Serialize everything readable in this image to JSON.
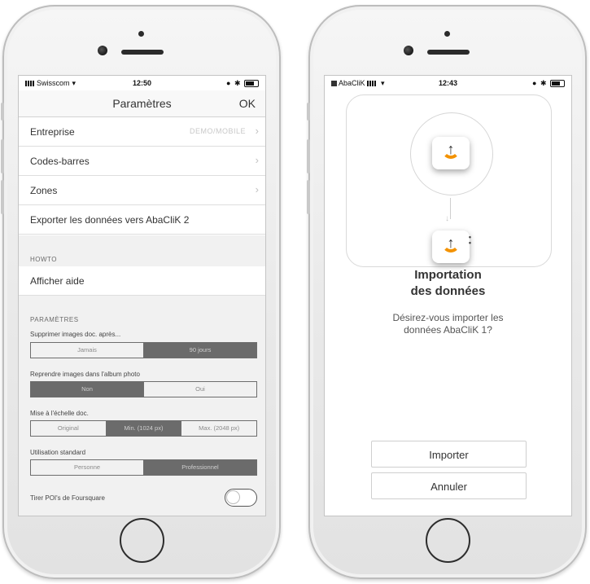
{
  "left": {
    "status": {
      "carrier": "Swisscom",
      "time": "12:50"
    },
    "nav": {
      "title": "Paramètres",
      "ok": "OK"
    },
    "rows": [
      {
        "label": "Entreprise",
        "value": "DEMO/MOBILE"
      },
      {
        "label": "Codes-barres",
        "value": ""
      },
      {
        "label": "Zones",
        "value": ""
      },
      {
        "label": "Exporter les données vers AbaCliK 2",
        "value": ""
      }
    ],
    "howto": {
      "section": "HOWTO",
      "item": "Afficher aide"
    },
    "settings": {
      "section": "PARAMÈTRES",
      "delete_images": {
        "label": "Supprimer images doc. après...",
        "options": [
          "Jamais",
          "90 jours"
        ],
        "selected": "90 jours"
      },
      "reuse_images": {
        "label": "Reprendre images dans l'album photo",
        "options": [
          "Non",
          "Oui"
        ],
        "selected": "Non"
      },
      "scaling": {
        "label": "Mise à l'échelle doc.",
        "options": [
          "Original",
          "Min. (1024 px)",
          "Max. (2048 px)"
        ],
        "selected": "Min. (1024 px)"
      },
      "usage": {
        "label": "Utilisation standard",
        "options": [
          "Personne",
          "Professionnel"
        ],
        "selected": "Professionnel"
      },
      "foursquare": {
        "label": "Tirer POI's de Foursquare",
        "enabled": false
      }
    }
  },
  "right": {
    "status": {
      "carrier": "AbaCliK",
      "time": "12:43"
    },
    "heading_line1": "Importation",
    "heading_line2": "des données",
    "question_line1": "Désirez-vous importer les",
    "question_line2": "données AbaCliK 1?",
    "import_button": "Importer",
    "cancel_button": "Annuler",
    "accent_color": "#f39200"
  }
}
